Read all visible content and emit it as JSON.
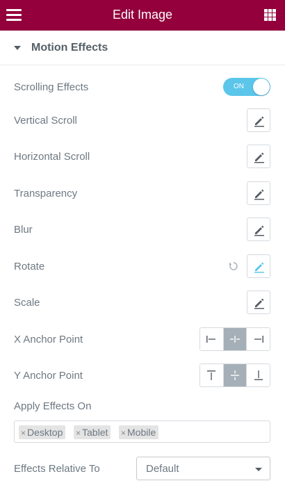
{
  "header": {
    "title": "Edit Image",
    "menu_icon": "hamburger-icon",
    "apps_icon": "grid-icon"
  },
  "section": {
    "title": "Motion Effects",
    "expanded": true
  },
  "scrolling_effects": {
    "label": "Scrolling Effects",
    "toggle_text": "ON",
    "enabled": true
  },
  "effects": [
    {
      "label": "Vertical Scroll"
    },
    {
      "label": "Horizontal Scroll"
    },
    {
      "label": "Transparency"
    },
    {
      "label": "Blur"
    },
    {
      "label": "Rotate",
      "active": true
    },
    {
      "label": "Scale"
    }
  ],
  "x_anchor": {
    "label": "X Anchor Point",
    "options": [
      "left",
      "center",
      "right"
    ],
    "selected": "center"
  },
  "y_anchor": {
    "label": "Y Anchor Point",
    "options": [
      "top",
      "center",
      "bottom"
    ],
    "selected": "center"
  },
  "apply_on": {
    "label": "Apply Effects On",
    "tags": [
      "Desktop",
      "Tablet",
      "Mobile"
    ],
    "remove_glyph": "×"
  },
  "relative_to": {
    "label": "Effects Relative To",
    "value": "Default"
  },
  "colors": {
    "brand": "#93003c",
    "accent": "#5bc5ea",
    "selected": "#a4afb7"
  }
}
